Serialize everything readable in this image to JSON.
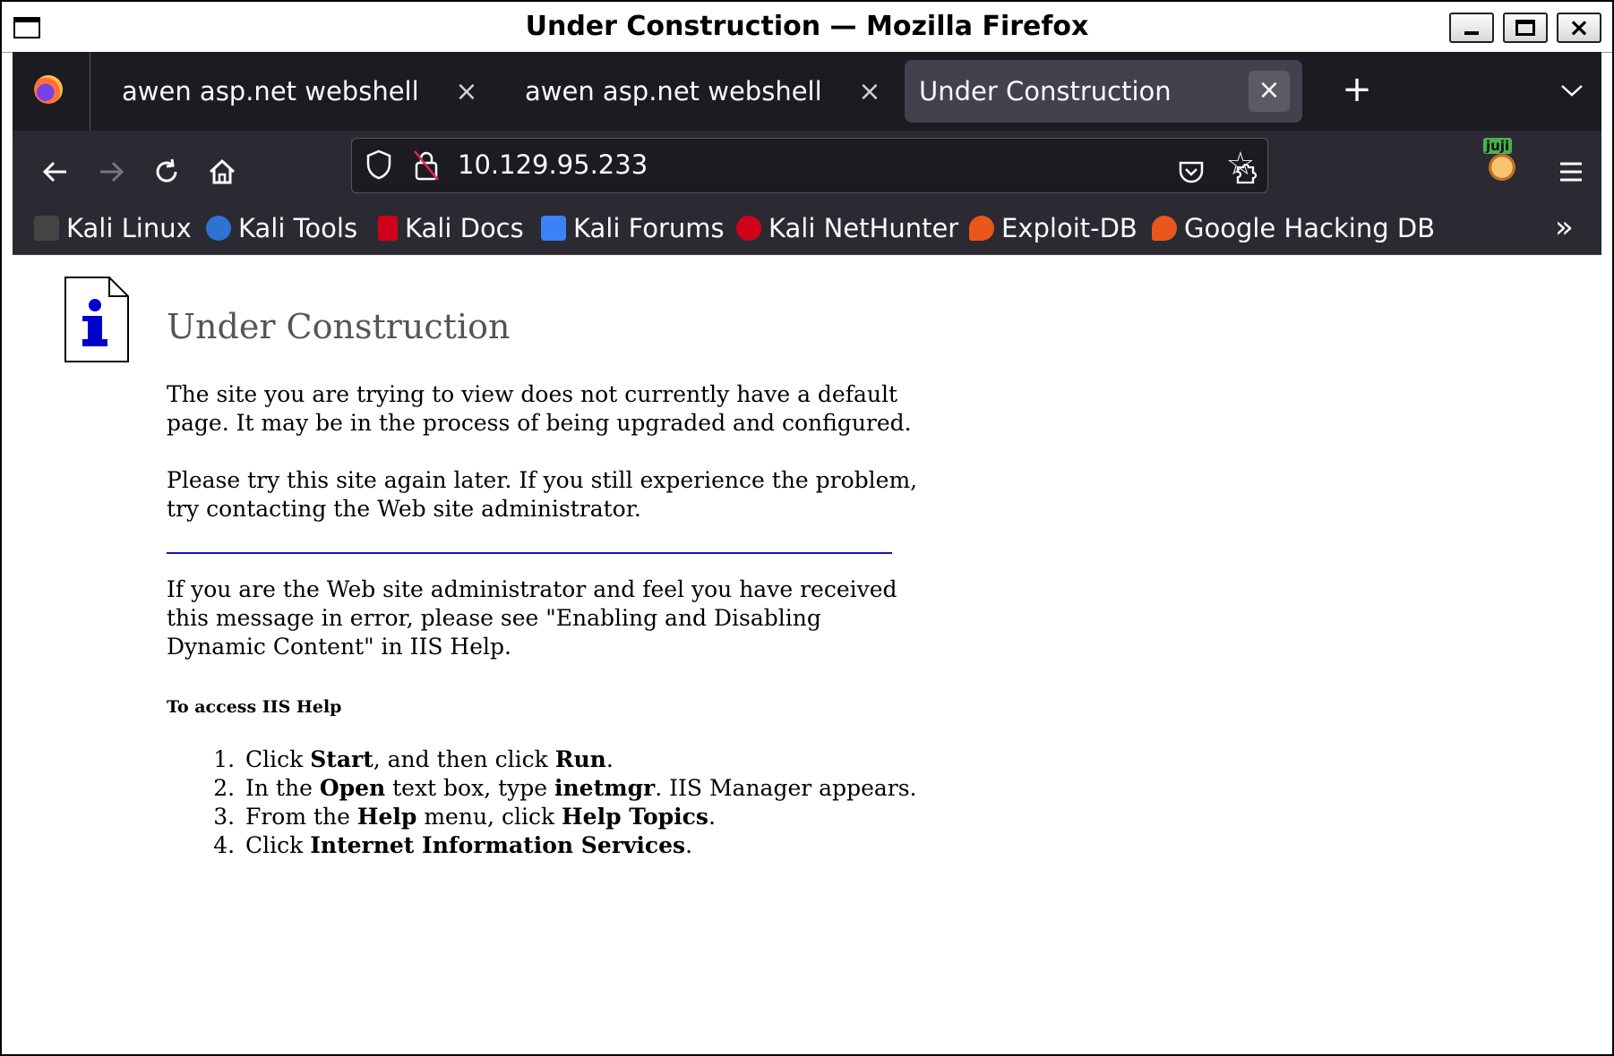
{
  "window": {
    "title": "Under Construction — Mozilla Firefox"
  },
  "tabs": [
    {
      "label": "awen asp.net webshell",
      "active": false
    },
    {
      "label": "awen asp.net webshell",
      "active": false
    },
    {
      "label": "Under Construction",
      "active": true
    }
  ],
  "tab_close_glyph": "×",
  "new_tab_glyph": "+",
  "address": {
    "url": "10.129.95.233"
  },
  "toolbar_icons": [
    "back-icon",
    "forward-icon",
    "reload-icon",
    "home-icon",
    "pocket-icon",
    "extensions-icon",
    "account-icon",
    "menu-icon"
  ],
  "avatar_badge": "juji",
  "bookmarks": [
    {
      "label": "Kali Linux",
      "icon": "kali-dragon-icon",
      "color": "#222222"
    },
    {
      "label": "Kali Tools",
      "icon": "kali-tools-icon",
      "color": "#2e72d2"
    },
    {
      "label": "Kali Docs",
      "icon": "kali-docs-icon",
      "color": "#d0021b"
    },
    {
      "label": "Kali Forums",
      "icon": "kali-forums-icon",
      "color": "#3b82f6"
    },
    {
      "label": "Kali NetHunter",
      "icon": "kali-nethunter-icon",
      "color": "#d0021b"
    },
    {
      "label": "Exploit-DB",
      "icon": "exploit-db-icon",
      "color": "#e8571c"
    },
    {
      "label": "Google Hacking DB",
      "icon": "ghdb-icon",
      "color": "#e8571c"
    }
  ],
  "page": {
    "heading": "Under Construction",
    "para1": "The site you are trying to view does not currently have a default page. It may be in the process of being upgraded and configured.",
    "para2": "Please try this site again later. If you still experience the problem, try contacting the Web site administrator.",
    "para3": "If you are the Web site administrator and feel you have received this message in error, please see \"Enabling and Disabling Dynamic Content\" in IIS Help.",
    "help_heading": "To access IIS Help",
    "steps": [
      {
        "pre": "Click ",
        "b1": "Start",
        "mid": ", and then click ",
        "b2": "Run",
        "post": "."
      },
      {
        "pre": "In the ",
        "b1": "Open",
        "mid": " text box, type ",
        "b2": "inetmgr",
        "post": ". IIS Manager appears."
      },
      {
        "pre": "From the ",
        "b1": "Help",
        "mid": " menu, click ",
        "b2": "Help Topics",
        "post": "."
      },
      {
        "pre": "Click ",
        "b1": "Internet Information Services",
        "mid": "",
        "b2": "",
        "post": "."
      }
    ]
  },
  "colors": {
    "toolbar_bg": "#2b2a33",
    "tabstrip_bg": "#1c1b22",
    "active_tab_bg": "#42414d",
    "rule_color": "#1010c0",
    "heading_color": "#555555"
  }
}
